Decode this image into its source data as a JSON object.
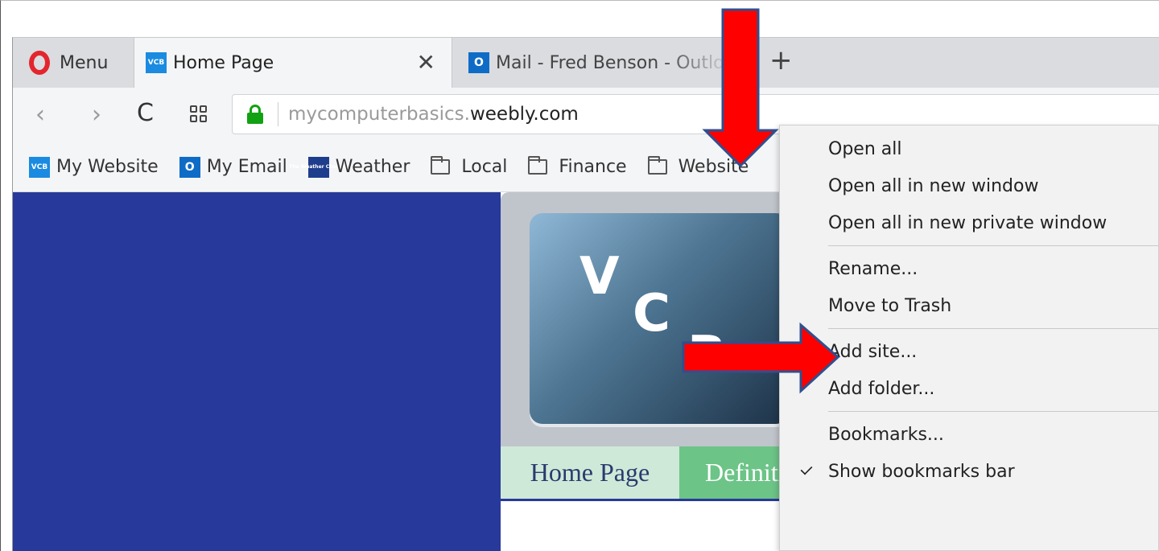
{
  "browser": {
    "menu_label": "Menu",
    "tabs": [
      {
        "favicon": "VCB",
        "title": "Home Page",
        "close": "✕"
      },
      {
        "favicon": "O",
        "title": "Mail - Fred Benson - Outlo"
      }
    ],
    "new_tab": "+",
    "address": {
      "back": "‹",
      "forward": "›",
      "reload": "C",
      "url_prefix": "mycomputerbasics.",
      "url_domain": "weebly.com"
    },
    "bookmarks": [
      {
        "icon": "vcb-favicon",
        "label": "My Website"
      },
      {
        "icon": "outlook-favicon",
        "label": "My Email"
      },
      {
        "icon": "weather-favicon",
        "label": "Weather"
      },
      {
        "icon": "folder-icon",
        "label": "Local"
      },
      {
        "icon": "folder-icon",
        "label": "Finance"
      },
      {
        "icon": "folder-icon",
        "label": "Website"
      }
    ]
  },
  "favicons": {
    "vcb": "VCB",
    "outlook": "O",
    "weather": "The Weather Channel"
  },
  "page": {
    "logo_letters": [
      "V",
      "C",
      "B"
    ],
    "nav": {
      "home": "Home Page",
      "definitions": "Definiti"
    }
  },
  "context_menu": {
    "items": [
      {
        "label": "Open all"
      },
      {
        "label": "Open all in new window"
      },
      {
        "label": "Open all in new private window"
      },
      {
        "label": "Rename..."
      },
      {
        "label": "Move to Trash"
      },
      {
        "label": "Add site..."
      },
      {
        "label": "Add folder..."
      },
      {
        "label": "Bookmarks..."
      },
      {
        "label": "Show bookmarks bar",
        "checked": true
      }
    ]
  },
  "colors": {
    "arrow_fill": "#ff0000",
    "arrow_stroke": "#2f4f8f",
    "page_blue": "#27399a",
    "nav_green": "#6cc487",
    "secure_green": "#12a112"
  }
}
